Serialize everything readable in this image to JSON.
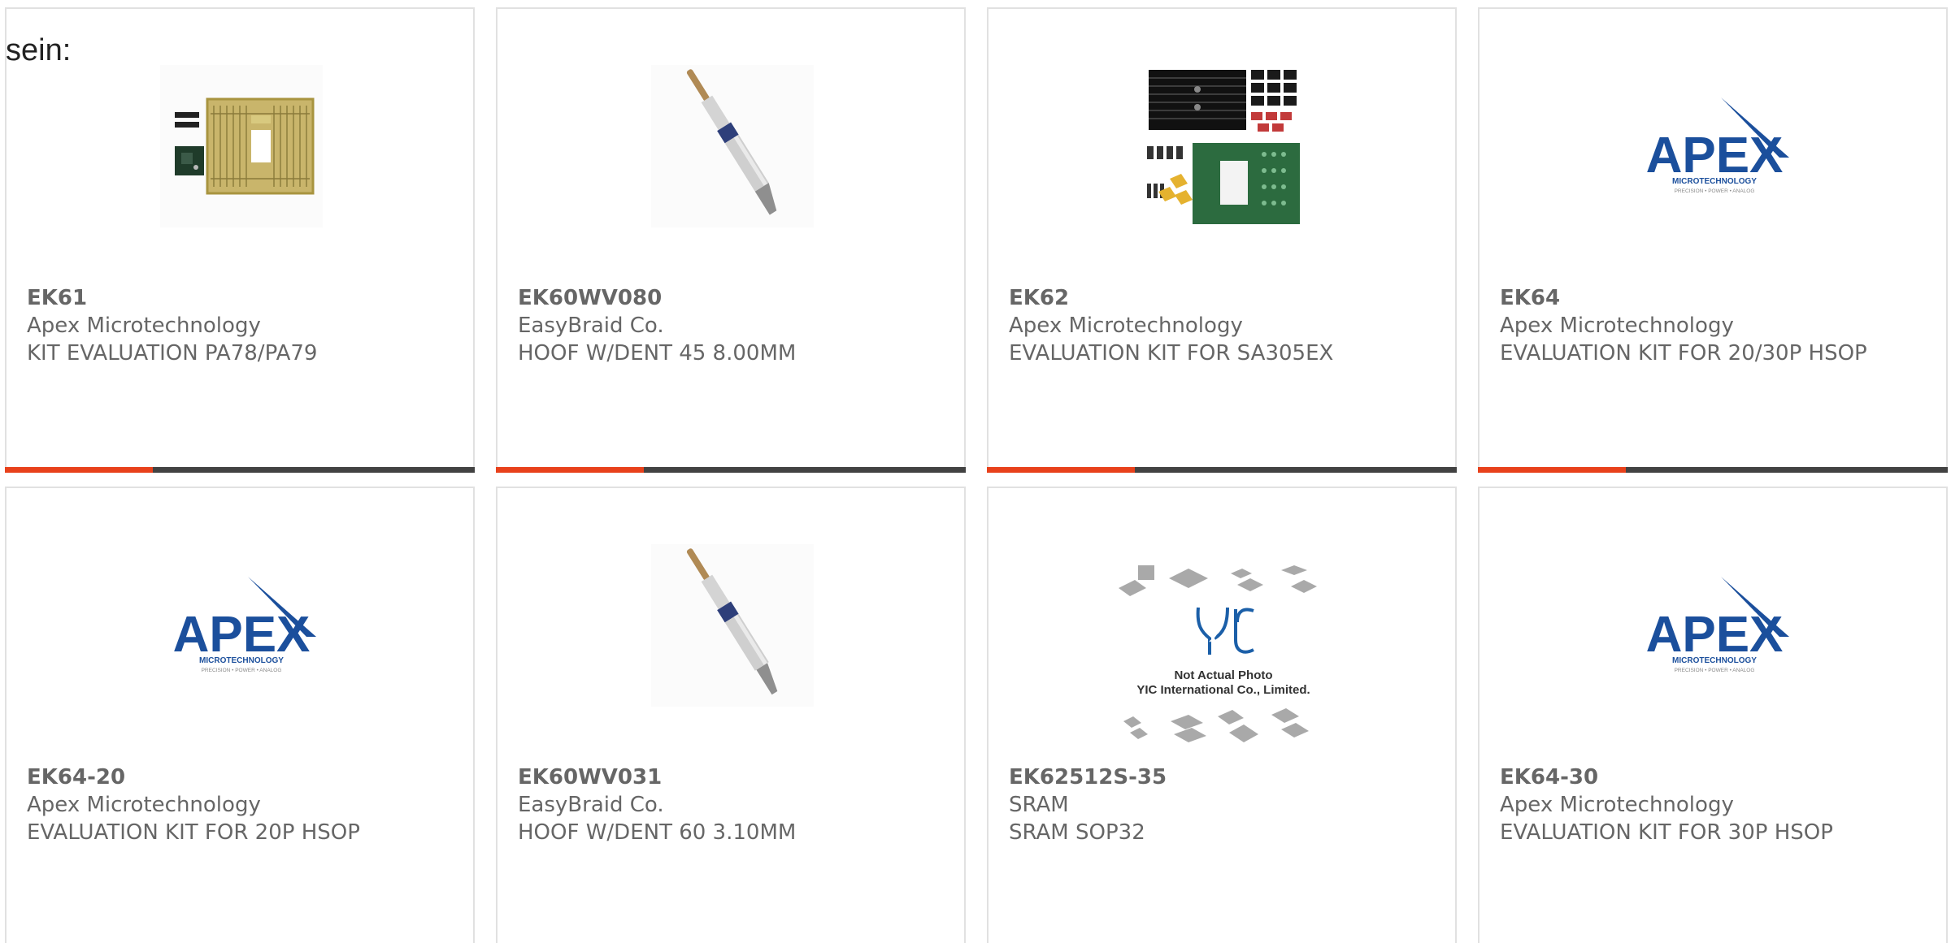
{
  "page": {
    "heading_fragment": "sein:"
  },
  "colors": {
    "accent": "#e8411b",
    "bar_dark": "#424242",
    "text": "#666666",
    "border": "#e1e1e1",
    "apex_blue": "#1b4f9c"
  },
  "products": [
    {
      "part_number": "EK61",
      "manufacturer": "Apex Microtechnology",
      "description": "KIT EVALUATION PA78/PA79",
      "image": "evaluation-kit-board-photo"
    },
    {
      "part_number": "EK60WV080",
      "manufacturer": "EasyBraid Co.",
      "description": "HOOF W/DENT 45 8.00MM",
      "image": "soldering-tip-photo"
    },
    {
      "part_number": "EK62",
      "manufacturer": "Apex Microtechnology",
      "description": "EVALUATION KIT FOR SA305EX",
      "image": "heatsink-kit-photo"
    },
    {
      "part_number": "EK64",
      "manufacturer": "Apex Microtechnology",
      "description": "EVALUATION KIT FOR 20/30P HSOP",
      "image": "apex-logo"
    },
    {
      "part_number": "EK64-20",
      "manufacturer": "Apex Microtechnology",
      "description": "EVALUATION KIT FOR 20P HSOP",
      "image": "apex-logo"
    },
    {
      "part_number": "EK60WV031",
      "manufacturer": "EasyBraid Co.",
      "description": "HOOF W/DENT 60 3.10MM",
      "image": "soldering-tip-photo"
    },
    {
      "part_number": "EK62512S-35",
      "manufacturer": "SRAM",
      "description": "SRAM SOP32",
      "image": "not-actual-photo-placeholder"
    },
    {
      "part_number": "EK64-30",
      "manufacturer": "Apex Microtechnology",
      "description": "EVALUATION KIT FOR 30P HSOP",
      "image": "apex-logo"
    }
  ],
  "logos": {
    "apex_word": "APEX",
    "apex_sub": "MICROTECHNOLOGY",
    "apex_tagline": "PRECISION • POWER • ANALOG",
    "yic_mark": "YIC",
    "yic_line1": "Not Actual Photo",
    "yic_line2": "YIC International Co., Limited."
  }
}
